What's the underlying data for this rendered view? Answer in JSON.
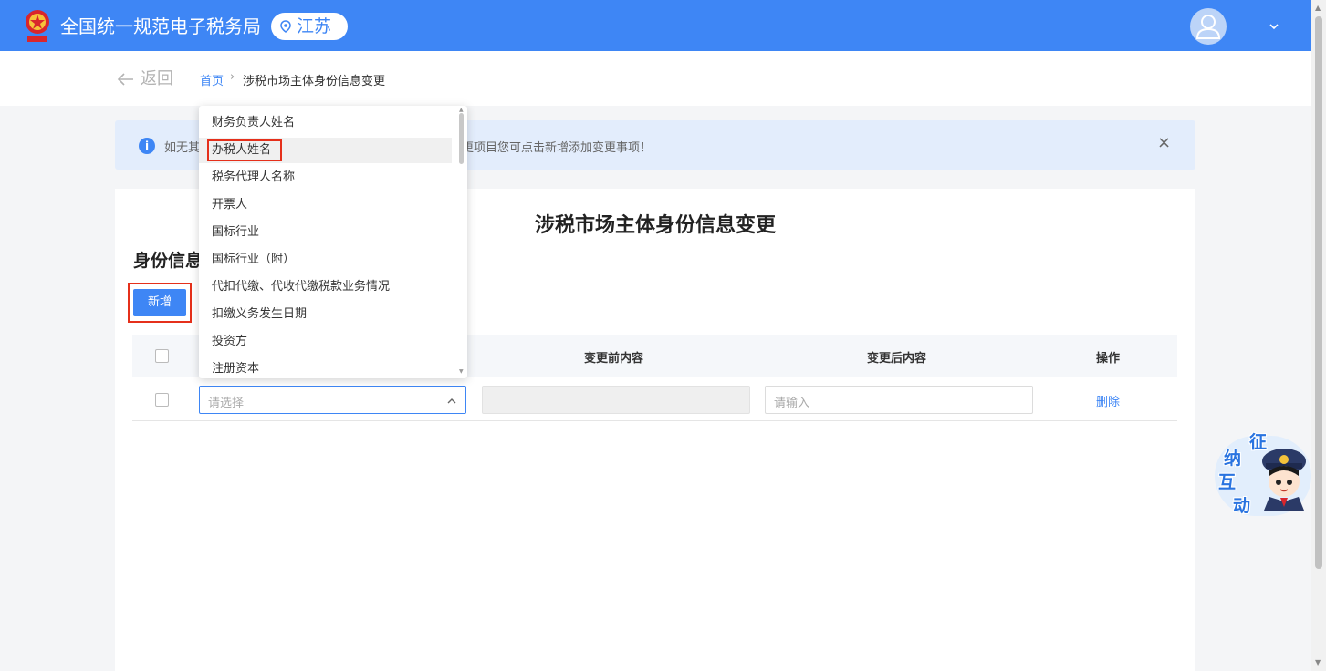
{
  "header": {
    "site_title": "全国统一规范电子税务局",
    "region": "江苏"
  },
  "breadcrumb": {
    "back_label": "返回",
    "home": "首页",
    "separator": "›",
    "current": "涉税市场主体身份信息变更"
  },
  "alert": {
    "text": "如无其他可变更项目您可点击新增添加变更事项！",
    "text_visible_left": "如无其",
    "text_visible_right": "更项目您可点击新增添加变更事项！",
    "close": "×"
  },
  "main": {
    "page_title": "涉税市场主体身份信息变更",
    "section_title": "身份信息",
    "add_button": "新增"
  },
  "table": {
    "headers": [
      "变更前内容",
      "变更后内容",
      "操作"
    ],
    "row": {
      "select_placeholder": "请选择",
      "after_placeholder": "请输入",
      "delete_label": "删除"
    }
  },
  "dropdown": {
    "options": [
      "财务负责人姓名",
      "办税人姓名",
      "税务代理人名称",
      "开票人",
      "国标行业",
      "国标行业（附）",
      "代扣代缴、代收代缴税款业务情况",
      "扣缴义务发生日期",
      "投资方",
      "注册资本"
    ],
    "highlighted_index": 1
  },
  "mascot": {
    "chars": [
      "征",
      "纳",
      "互",
      "动"
    ]
  },
  "colors": {
    "accent": "#3e86f5",
    "highlight_box": "#e5301b",
    "alert_bg": "#e3edfc"
  }
}
